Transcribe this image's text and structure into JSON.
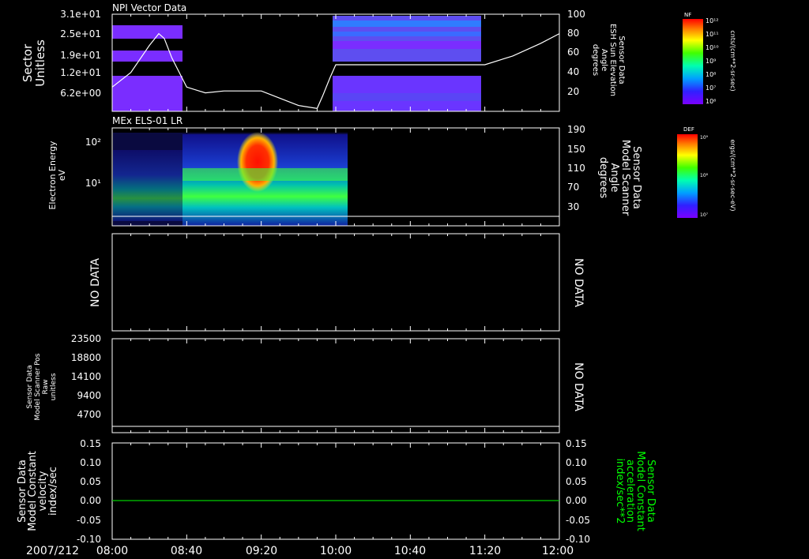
{
  "date_label": "2007/212",
  "time_ticks": [
    "08:00",
    "08:40",
    "09:20",
    "10:00",
    "10:40",
    "11:20",
    "12:00"
  ],
  "panels": {
    "p1": {
      "title": "NPI Vector Data",
      "ylabel": [
        "Sector",
        "Unitless"
      ],
      "yticks": [
        "3.1e+01",
        "2.5e+01",
        "1.9e+01",
        "1.2e+01",
        "6.2e+00"
      ],
      "right_ticks": [
        "100",
        "80",
        "60",
        "40",
        "20"
      ],
      "right_label": [
        "Sensor Data",
        "ESH Sun Elevation",
        "Angle",
        "degrees"
      ],
      "colorbar": {
        "title": "NF",
        "ticks": [
          "10¹²",
          "10¹¹",
          "10¹⁰",
          "10⁹",
          "10⁸",
          "10⁷",
          "10⁶"
        ],
        "units": "cnts/(cm**2-sr-sec)"
      }
    },
    "p2": {
      "title": "MEx ELS-01 LR",
      "ylabel": [
        "Electron Energy",
        "eV"
      ],
      "yticks": [
        "10²",
        "10¹"
      ],
      "right_ticks": [
        "190",
        "150",
        "110",
        "70",
        "30"
      ],
      "right_label": [
        "Sensor Data",
        "Model Scanner",
        "Angle",
        "degrees"
      ],
      "colorbar": {
        "title": "DEF",
        "ticks": [
          "10⁹",
          "10⁸",
          "10⁷"
        ],
        "units": "ergs/(cm**2-sr-sec-eV)"
      }
    },
    "p3": {
      "left_text": "NO DATA",
      "right_text": "NO DATA"
    },
    "p4": {
      "ylabel": [
        "Sensor Data",
        "Model Scanner Pos",
        "Raw",
        "unitless"
      ],
      "yticks": [
        "23500",
        "18800",
        "14100",
        "9400",
        "4700"
      ],
      "right_text": "NO DATA"
    },
    "p5": {
      "ylabel": [
        "Sensor Data",
        "Model Constant",
        "velocity",
        "index/sec"
      ],
      "yticks": [
        "0.15",
        "0.10",
        "0.05",
        "0.00",
        "-0.05",
        "-0.10"
      ],
      "right_ticks": [
        "0.15",
        "0.10",
        "0.05",
        "0.00",
        "-0.05",
        "-0.10"
      ],
      "right_label": [
        "Sensor Data",
        "Model Constant",
        "acceleration",
        "index/sec**2"
      ],
      "right_label_color": "#00ff00"
    }
  },
  "chart_data": [
    {
      "type": "heatmap",
      "title": "NPI Vector Data",
      "ylabel": "Sector Unitless",
      "x_range": [
        "08:00",
        "12:00"
      ],
      "overlay_series": {
        "name": "Sensor Data ESH Sun Elevation Angle degrees",
        "y_range": [
          0,
          100
        ],
        "x_minutes": [
          0,
          10,
          20,
          25,
          28,
          32,
          40,
          50,
          60,
          80,
          100,
          110,
          113,
          117,
          120,
          130,
          150,
          180,
          200,
          215,
          230,
          240
        ],
        "values": [
          25,
          40,
          68,
          80,
          75,
          55,
          25,
          19,
          21,
          21,
          6,
          3,
          16,
          35,
          48,
          48,
          48,
          48,
          48,
          57,
          70,
          80
        ]
      },
      "color": "#ffffff"
    },
    {
      "type": "heatmap",
      "title": "MEx ELS-01 LR",
      "ylabel": "Electron Energy eV",
      "y_scale": "log",
      "x_range": [
        "08:00",
        "12:00"
      ],
      "overlay_series": {
        "name": "Sensor Data Model Scanner Angle degrees",
        "y_range": [
          0,
          190
        ],
        "values_constant": 13
      }
    },
    {
      "type": "line",
      "ylabel": "Sensor Data Model Constant velocity index/sec",
      "ylim": [
        -0.1,
        0.15
      ],
      "x_range": [
        "08:00",
        "12:00"
      ],
      "series": [
        {
          "values_constant": 0.0,
          "color": "#00cc00"
        }
      ]
    }
  ]
}
